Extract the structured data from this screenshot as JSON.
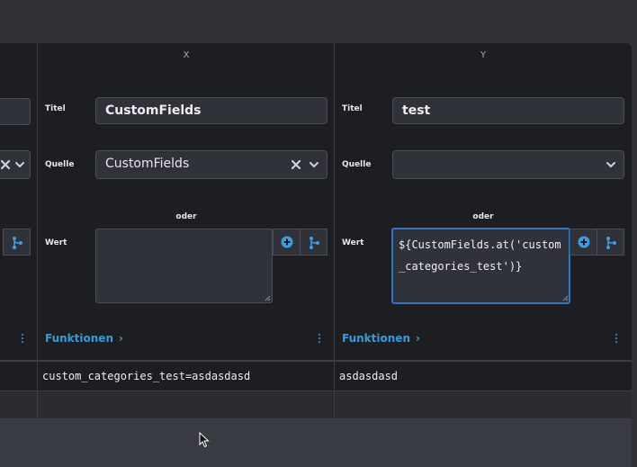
{
  "columns": [
    {
      "header": "X"
    },
    {
      "header": "Y"
    }
  ],
  "labels": {
    "titel": "Titel",
    "quelle": "Quelle",
    "wert": "Wert",
    "oder": "oder",
    "funktionen": "Funktionen"
  },
  "col_x": {
    "titel_value": "CustomFields",
    "quelle_value": "CustomFields",
    "wert_value": ""
  },
  "col_y": {
    "titel_value": "test",
    "quelle_value": "",
    "wert_value": "${CustomFields.at('custom_categories_test')}"
  },
  "results": {
    "row1": {
      "x": "custom_categories_test=asdasdasd",
      "y": "asdasdasd"
    }
  },
  "colors": {
    "accent": "#2b9fe0",
    "focus_border": "#2f74c6",
    "panel_bg": "#1c1e22",
    "field_bg": "#2f3238"
  }
}
